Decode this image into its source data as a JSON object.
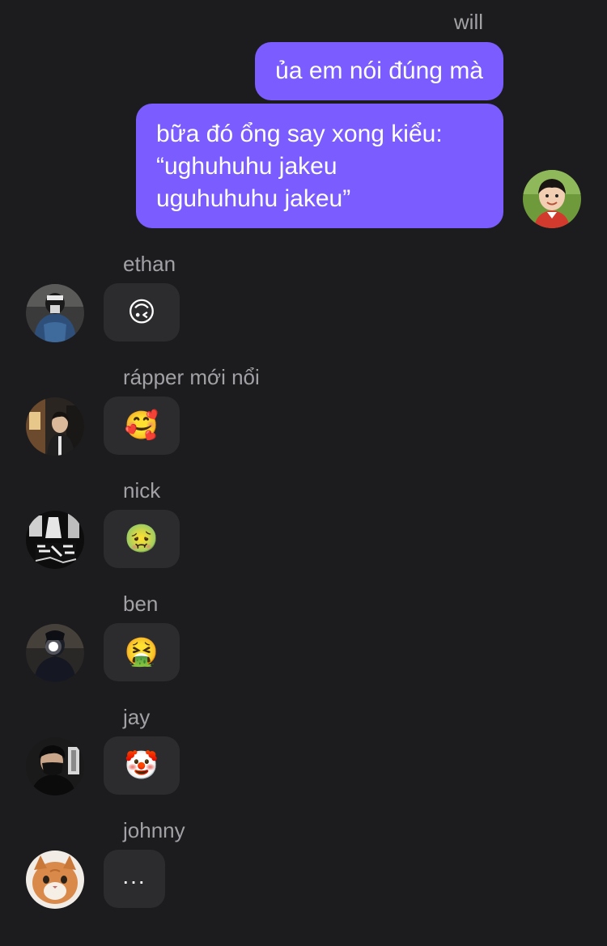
{
  "outgoing": {
    "sender": "will",
    "messages": [
      "ủa em nói đúng mà",
      "bữa đó ổng say xong kiểu:\n“ughuhuhu jakeu\nuguhuhuhu jakeu”"
    ]
  },
  "incoming": [
    {
      "sender": "ethan",
      "message": "🙃"
    },
    {
      "sender": "rápper mới nổi",
      "message": "🥰"
    },
    {
      "sender": "nick",
      "message": "🤢"
    },
    {
      "sender": "ben",
      "message": "🤮"
    },
    {
      "sender": "jay",
      "message": "🤡"
    },
    {
      "sender": "johnny",
      "message": "..."
    }
  ],
  "colors": {
    "background": "#1c1c1e",
    "outgoing_bubble": "#7b5cff",
    "incoming_bubble": "#2c2c2e",
    "sender_name": "#a1a1a6"
  }
}
